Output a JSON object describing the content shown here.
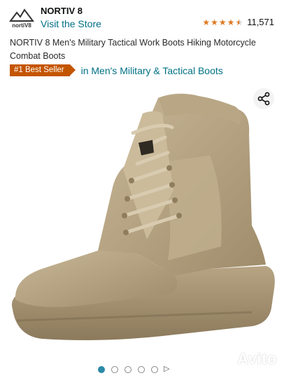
{
  "header": {
    "brand_logo_text": "nortiV8",
    "brand_name": "NORTIV 8",
    "visit_store": "Visit the Store",
    "rating_value": 4.5,
    "rating_count": "11,571"
  },
  "product": {
    "title": "NORTIV 8 Men's Military Tactical Work Boots Hiking Motorcycle Combat Boots",
    "badge": "#1 Best Seller",
    "category": "in Men's Military & Tactical Boots"
  },
  "gallery": {
    "image_count": 5,
    "active_index": 0,
    "has_video": true
  },
  "icons": {
    "share": "share-icon",
    "play": "play-icon"
  },
  "watermark": {
    "text": "Avito"
  },
  "colors": {
    "link": "#007185",
    "badge": "#c45500",
    "star": "#de7921",
    "active_dot": "#2b8aa8"
  }
}
